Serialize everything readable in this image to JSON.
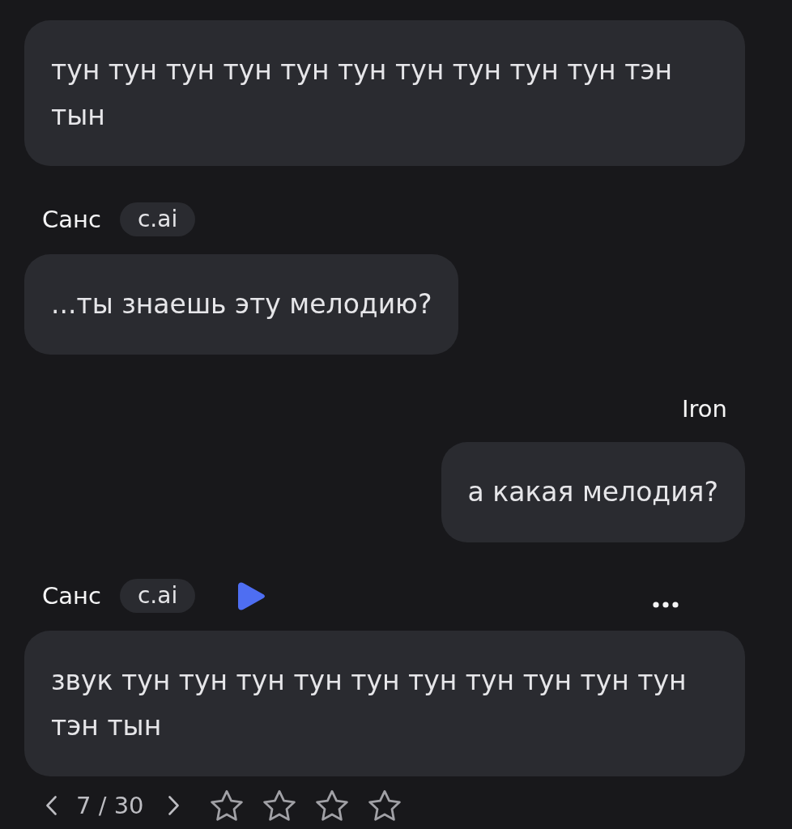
{
  "messages": [
    {
      "kind": "bot",
      "text": "тун тун тун тун тун тун тун тун тун тун тэн тын",
      "latest": false
    },
    {
      "kind": "bot",
      "name": "Санс",
      "badge": "c.ai",
      "text": "...ты знаешь эту мелодию?",
      "latest": false
    },
    {
      "kind": "user",
      "name": "Iron",
      "text": "а какая мелодия?",
      "latest": false
    },
    {
      "kind": "bot",
      "name": "Санс",
      "badge": "c.ai",
      "text": "звук тун тун тун тун тун тун тун тун тун тун тэн тын",
      "latest": true
    }
  ],
  "pager": {
    "position": "7 / 30"
  },
  "rating": {
    "stars": 0
  }
}
